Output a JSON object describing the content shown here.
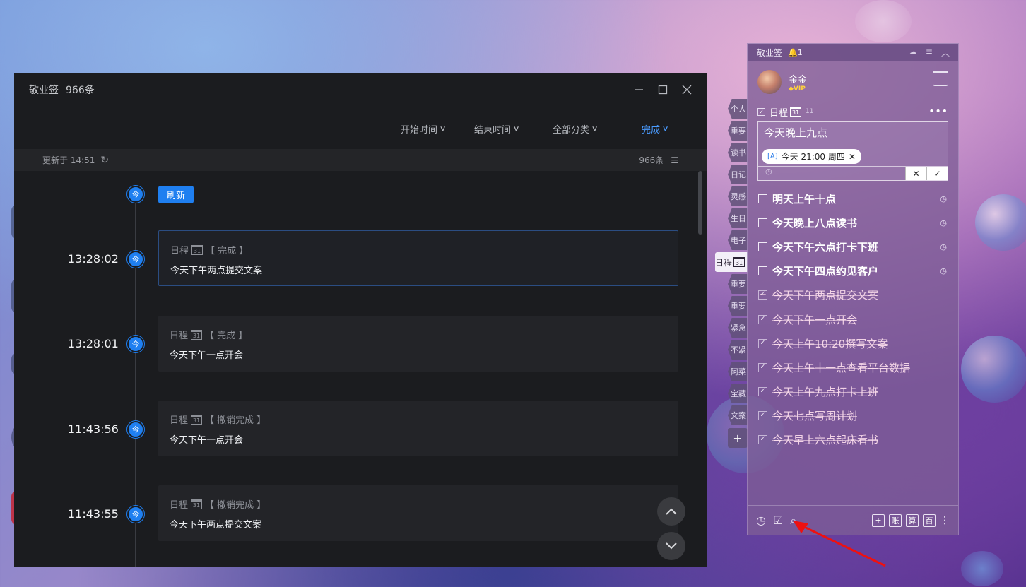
{
  "desktop": {
    "icons": [
      "icon1",
      "icon2",
      "icon3",
      "icon4",
      "icon5"
    ]
  },
  "main_window": {
    "title": "敬业签",
    "count": "966条",
    "filters": {
      "start_time": "开始时间",
      "end_time": "结束时间",
      "category": "全部分类",
      "status": "完成"
    },
    "status_bar": {
      "updated": "更新于 14:51",
      "total": "966条"
    },
    "refresh_button": "刷新",
    "today_dot": "今",
    "entries": [
      {
        "time": "13:28:02",
        "type": "日程",
        "badge": "31",
        "action": "【 完成 】",
        "text": "今天下午两点提交文案"
      },
      {
        "time": "13:28:01",
        "type": "日程",
        "badge": "31",
        "action": "【 完成 】",
        "text": "今天下午一点开会"
      },
      {
        "time": "11:43:56",
        "type": "日程",
        "badge": "31",
        "action": "【 撤销完成 】",
        "text": "今天下午一点开会"
      },
      {
        "time": "11:43:55",
        "type": "日程",
        "badge": "31",
        "action": "【 撤销完成 】",
        "text": "今天下午两点提交文案"
      }
    ]
  },
  "side_tabs": [
    "个人",
    "重要",
    "读书",
    "日记",
    "灵感",
    "生日",
    "电子",
    "日程",
    "重要",
    "重要",
    "紧急",
    "不紧",
    "阿菜",
    "宝藏",
    "文案"
  ],
  "side_tab_active_badge": "31",
  "note_window": {
    "app_name": "敬业签",
    "notify_count": "1",
    "user": {
      "name": "金金",
      "vip": "VIP"
    },
    "schedule": {
      "title": "日程",
      "badge": "31",
      "count": "11"
    },
    "editor": {
      "text": "今天晚上九点",
      "date_chip": "今天 21:00 周四"
    },
    "todos": [
      {
        "text": "明天上午十点",
        "done": false
      },
      {
        "text": "今天晚上八点读书",
        "done": false
      },
      {
        "text": "今天下午六点打卡下班",
        "done": false
      },
      {
        "text": "今天下午四点约见客户",
        "done": false
      },
      {
        "text": "今天下午两点提交文案",
        "done": true
      },
      {
        "text": "今天下午一点开会",
        "done": true
      },
      {
        "text": "今天上午10:20撰写文案",
        "done": true
      },
      {
        "text": "今天上午十一点查看平台数据",
        "done": true
      },
      {
        "text": "今天上午九点打卡上班",
        "done": true
      },
      {
        "text": "今天七点写周计划",
        "done": true
      },
      {
        "text": "今天早上六点起床看书",
        "done": true
      }
    ],
    "footer_buttons": [
      "+",
      "账",
      "算",
      "百"
    ]
  }
}
